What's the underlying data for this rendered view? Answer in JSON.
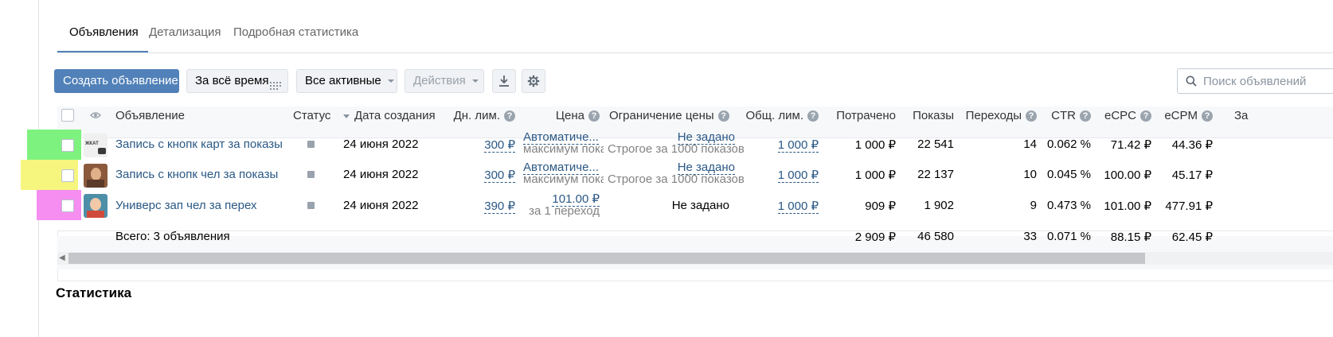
{
  "tabs": [
    {
      "label": "Объявления",
      "active": true
    },
    {
      "label": "Детализация",
      "active": false
    },
    {
      "label": "Подробная статистика",
      "active": false
    }
  ],
  "toolbar": {
    "create_label": "Создать объявление",
    "period_label": "За всё время",
    "filter_label": "Все активные",
    "actions_label": "Действия",
    "download_icon": "download-icon",
    "settings_icon": "gear-icon"
  },
  "search": {
    "placeholder": "Поиск объявлений"
  },
  "table": {
    "headers": {
      "ad": "Объявление",
      "status": "Статус",
      "created": "Дата создания",
      "daily_limit": "Дн. лим.",
      "price": "Цена",
      "price_limit": "Ограничение цены",
      "total_limit": "Общ. лим.",
      "spent": "Потрачено",
      "impressions": "Показы",
      "clicks": "Переходы",
      "ctr": "CTR",
      "ecpc": "eCPC",
      "ecpm": "eCPM",
      "extra": "За"
    },
    "rows": [
      {
        "title": "Запись с кнопк карт за показы",
        "created": "24 июня 2022",
        "daily_limit": "300 ₽",
        "price_main": "Автоматиче...",
        "price_sub": "максимум пока:",
        "price_limit_main": "Не задано",
        "price_limit_sub": "Строгое за 1000 показов",
        "total_limit": "1 000 ₽",
        "spent": "1 000 ₽",
        "impressions": "22 541",
        "clicks": "14",
        "ctr": "0.062 %",
        "ecpc": "71.42 ₽",
        "ecpm": "44.36 ₽",
        "highlight": "#7ef27e"
      },
      {
        "title": "Запись с кнопк чел за показы",
        "created": "24 июня 2022",
        "daily_limit": "300 ₽",
        "price_main": "Автоматиче...",
        "price_sub": "максимум пока:",
        "price_limit_main": "Не задано",
        "price_limit_sub": "Строгое за 1000 показов",
        "total_limit": "1 000 ₽",
        "spent": "1 000 ₽",
        "impressions": "22 137",
        "clicks": "10",
        "ctr": "0.045 %",
        "ecpc": "100.00 ₽",
        "ecpm": "45.17 ₽",
        "highlight": "#f6f67e"
      },
      {
        "title": "Универс зап чел за перех",
        "created": "24 июня 2022",
        "daily_limit": "390 ₽",
        "price_main": "101.00 ₽",
        "price_sub": "за 1 переход",
        "price_limit_main": "Не задано",
        "price_limit_sub": "",
        "total_limit": "1 000 ₽",
        "spent": "909 ₽",
        "impressions": "1 902",
        "clicks": "9",
        "ctr": "0.473 %",
        "ecpc": "101.00 ₽",
        "ecpm": "477.91 ₽",
        "highlight": "#f58ef0"
      }
    ],
    "total": {
      "label": "Всего: 3 объявления",
      "spent": "2 909 ₽",
      "impressions": "46 580",
      "clicks": "33",
      "ctr": "0.071 %",
      "ecpc": "88.15 ₽",
      "ecpm": "62.45 ₽"
    }
  },
  "section_title": "Статистика",
  "colors": {
    "accent": "#5181b8",
    "link": "#2a5885"
  }
}
